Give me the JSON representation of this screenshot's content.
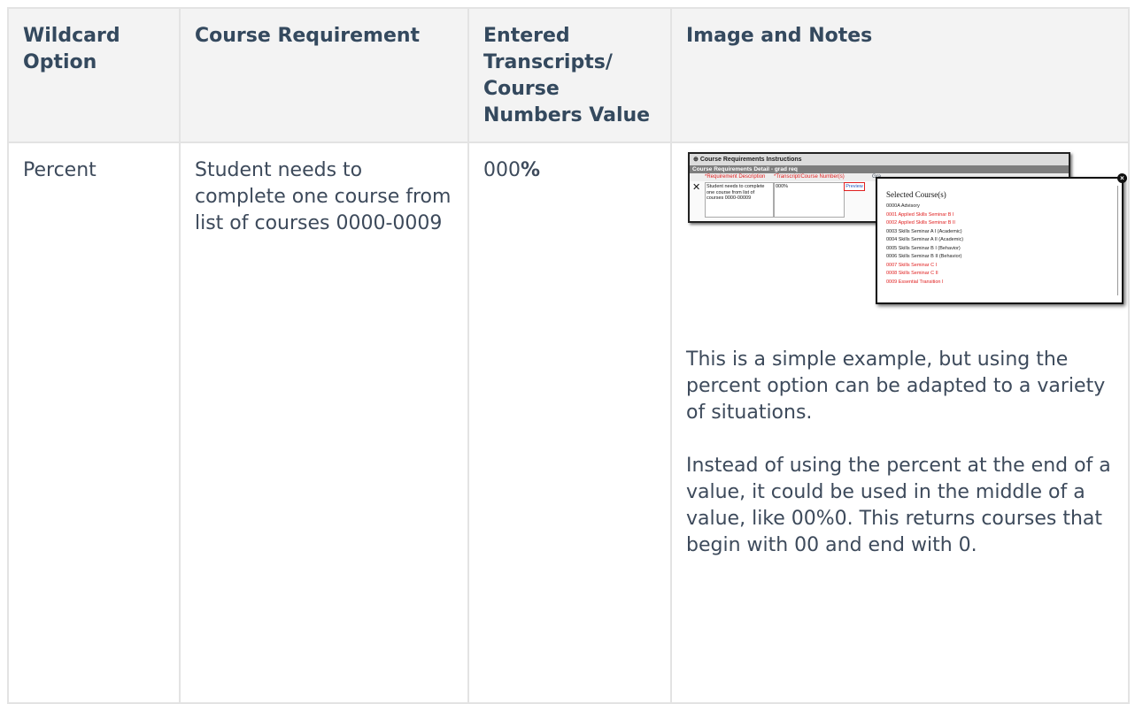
{
  "table": {
    "headers": [
      "Wildcard Option",
      "Course Requirement",
      "Entered Transcripts/ Course Numbers Value",
      "Image and Notes"
    ],
    "row": {
      "wildcard_option": "Percent",
      "course_requirement": "Student needs to complete one course from list of courses 0000-0009",
      "value_prefix": "000",
      "value_symbol": "%",
      "notes": [
        "This is a simple example, but using the percent option can be adapted to a variety of situations.",
        "Instead of using the percent at the end of a value, it could be used in the middle of a value, like 00%0. This returns courses that begin with 00 and end with 0."
      ]
    }
  },
  "screenshot": {
    "instructions_header": "Course Requirements Instructions",
    "detail_header": "Course Requirements Detail - grad req",
    "col_requirement_description": "*Requirement Description",
    "col_transcript_course_numbers": "*Transcript/Course Number(s)",
    "col_gra": "Gra",
    "remove_mark": "✕",
    "description_value": "Student needs to complete one course from list of courses 0000-00009",
    "course_numbers_value": "000%",
    "preview_label": "Preview",
    "selected_title": "Selected Course(s)",
    "close_glyph": "×",
    "courses": [
      {
        "text": "0000A Advisory",
        "highlight": false
      },
      {
        "text": "0001 Applied Skills Seminar B I",
        "highlight": true
      },
      {
        "text": "0002 Applied Skills Seminar B II",
        "highlight": true
      },
      {
        "text": "0003 Skills Seminar A I (Academic)",
        "highlight": false
      },
      {
        "text": "0004 Skills Seminar A II (Academic)",
        "highlight": false
      },
      {
        "text": "0005 Skills Seminar B I (Behavior)",
        "highlight": false
      },
      {
        "text": "0006 Skills Seminar B II (Behavior)",
        "highlight": false
      },
      {
        "text": "0007 Skills Seminar C I",
        "highlight": true
      },
      {
        "text": "0008 Skills Seminar C II",
        "highlight": true
      },
      {
        "text": "0009 Essential Transition I",
        "highlight": true
      }
    ]
  }
}
